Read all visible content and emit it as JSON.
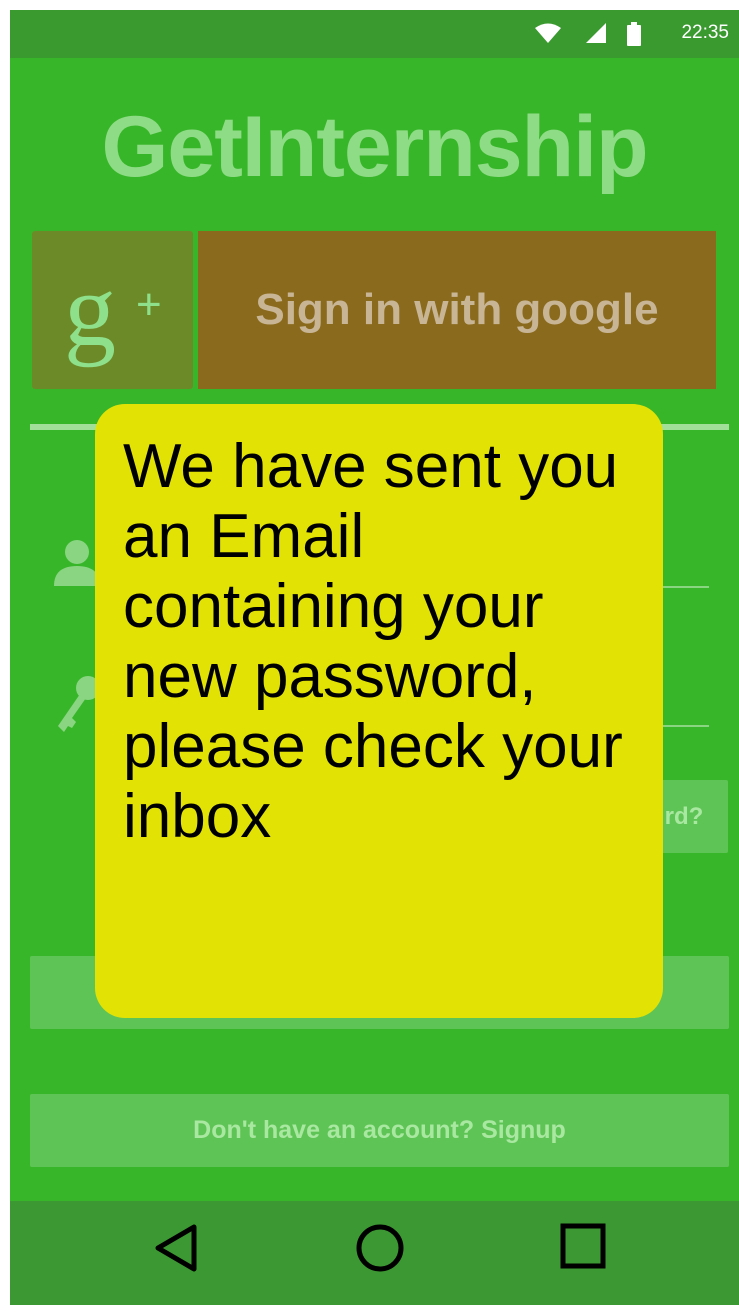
{
  "status_bar": {
    "time": "22:35",
    "icons": [
      "wifi-icon",
      "signal-icon",
      "battery-icon"
    ]
  },
  "app": {
    "title": "GetInternship"
  },
  "google_signin": {
    "icon": "google-plus-icon",
    "icon_glyph": "g",
    "icon_plus": "+",
    "label": "Sign in with google"
  },
  "login_form": {
    "username_icon": "user-icon",
    "password_icon": "key-icon",
    "forgot_label": "rd?"
  },
  "signup": {
    "label": "Don't have an account? Signup"
  },
  "toast": {
    "message": "We have sent you an Email containing your new password, please check your inbox"
  },
  "navigation_bar": {
    "buttons": [
      "back-icon",
      "home-icon",
      "recents-icon"
    ]
  },
  "colors": {
    "background": "#38b62a",
    "status_bar": "#3a9a30",
    "nav_bar": "#3c9832",
    "toast": "#e2e205",
    "google_button": "#8a6a1c",
    "google_icon_box": "#6c8b28",
    "title": "#8fdc86"
  }
}
